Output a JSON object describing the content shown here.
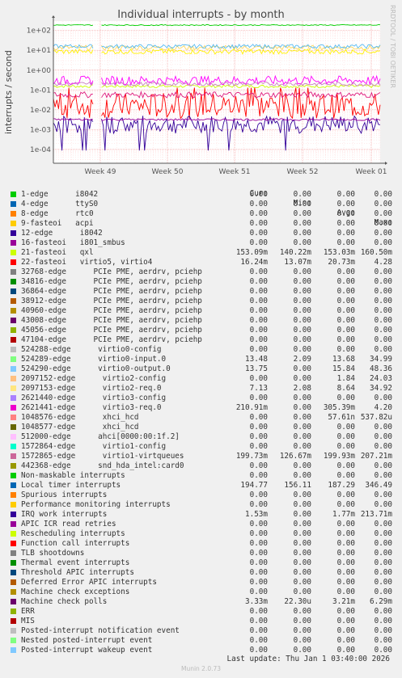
{
  "title": "Individual interrupts - by month",
  "side_label": "RRDTOOL / TOBI OETIKER",
  "ylabel": "interrupts / second",
  "footer": "Munin 2.0.73",
  "last_update": "Last update: Thu Jan  1 03:40:00 2026",
  "legend_headers": {
    "cur": "Cur:",
    "min": "Min:",
    "avg": "Avg:",
    "max": "Max:"
  },
  "chart_data": {
    "type": "line",
    "title": "Individual interrupts - by month",
    "ylabel": "interrupts / second",
    "yscale": "log",
    "ylim": [
      2e-05,
      300
    ],
    "y_ticks": [
      "1e+02",
      "1e+01",
      "1e+00",
      "1e-01",
      "1e-02",
      "1e-03",
      "1e-04"
    ],
    "x_ticks": [
      "Week 49",
      "Week 50",
      "Week 51",
      "Week 52",
      "Week 01"
    ],
    "grid": true,
    "series": [
      {
        "name": "21-fasteoi   qxl",
        "color": "#CCFF00",
        "level": 0.153,
        "noise": 0.15
      },
      {
        "name": "22-fasteoi   virtio5, virtio4",
        "color": "#FF0000",
        "level": 0.0162,
        "noise": 1.3
      },
      {
        "name": "524289-edge      virtio0-input.0",
        "color": "#FFD660",
        "level": 13.5,
        "noise": 0.25
      },
      {
        "name": "524290-edge      virtio0-output.0",
        "color": "#55BAF2",
        "level": 15.8,
        "noise": 0.2
      },
      {
        "name": "2097153-edge      virtio2-req.0",
        "color": "#FFF200",
        "level": 8.6,
        "noise": 0.25
      },
      {
        "name": "2621441-edge      virtio3-req.0",
        "color": "#FF00FF",
        "level": 0.3,
        "noise": 0.45
      },
      {
        "name": "1048576-edge      xhci_hcd",
        "color": "#DE1A7D",
        "level": 0.057,
        "noise": 0.3
      },
      {
        "name": "1572865-edge      virtio1-virtqueues",
        "color": "#C880C0",
        "level": 0.2,
        "noise": 0.2
      },
      {
        "name": "Local timer interrupts",
        "color": "#00CF00",
        "level": 187,
        "noise": 0.05
      },
      {
        "name": "IRQ work interrupts",
        "color": "#330099",
        "level": 0.00177,
        "noise": 0.9
      },
      {
        "name": "Machine check polls",
        "color": "#990099",
        "level": 0.0032,
        "noise": 0.1
      }
    ]
  },
  "legend": [
    {
      "name": "1-edge      i8042",
      "color": "#00CC00",
      "cur": "0.00",
      "min": "0.00",
      "avg": "0.00",
      "max": "0.00"
    },
    {
      "name": "4-edge      ttyS0",
      "color": "#0066B3",
      "cur": "0.00",
      "min": "0.00",
      "avg": "0.00",
      "max": "0.00"
    },
    {
      "name": "8-edge      rtc0",
      "color": "#FF8000",
      "cur": "0.00",
      "min": "0.00",
      "avg": "0.00",
      "max": "0.00"
    },
    {
      "name": "9-fasteoi   acpi",
      "color": "#FFCC00",
      "cur": "0.00",
      "min": "0.00",
      "avg": "0.00",
      "max": "0.00"
    },
    {
      "name": "12-edge      i8042",
      "color": "#330099",
      "cur": "0.00",
      "min": "0.00",
      "avg": "0.00",
      "max": "0.00"
    },
    {
      "name": "16-fasteoi   i801_smbus",
      "color": "#990099",
      "cur": "0.00",
      "min": "0.00",
      "avg": "0.00",
      "max": "0.00"
    },
    {
      "name": "21-fasteoi   qxl",
      "color": "#CCFF00",
      "cur": "153.09m",
      "min": "140.22m",
      "avg": "153.03m",
      "max": "160.50m"
    },
    {
      "name": "22-fasteoi   virtio5, virtio4",
      "color": "#FF0000",
      "cur": "16.24m",
      "min": "13.07m",
      "avg": "20.73m",
      "max": "4.28"
    },
    {
      "name": "32768-edge      PCIe PME, aerdrv, pciehp",
      "color": "#808080",
      "cur": "0.00",
      "min": "0.00",
      "avg": "0.00",
      "max": "0.00"
    },
    {
      "name": "34816-edge      PCIe PME, aerdrv, pciehp",
      "color": "#008F00",
      "cur": "0.00",
      "min": "0.00",
      "avg": "0.00",
      "max": "0.00"
    },
    {
      "name": "36864-edge      PCIe PME, aerdrv, pciehp",
      "color": "#00487D",
      "cur": "0.00",
      "min": "0.00",
      "avg": "0.00",
      "max": "0.00"
    },
    {
      "name": "38912-edge      PCIe PME, aerdrv, pciehp",
      "color": "#B35A00",
      "cur": "0.00",
      "min": "0.00",
      "avg": "0.00",
      "max": "0.00"
    },
    {
      "name": "40960-edge      PCIe PME, aerdrv, pciehp",
      "color": "#B38F00",
      "cur": "0.00",
      "min": "0.00",
      "avg": "0.00",
      "max": "0.00"
    },
    {
      "name": "43008-edge      PCIe PME, aerdrv, pciehp",
      "color": "#6B006B",
      "cur": "0.00",
      "min": "0.00",
      "avg": "0.00",
      "max": "0.00"
    },
    {
      "name": "45056-edge      PCIe PME, aerdrv, pciehp",
      "color": "#8FB300",
      "cur": "0.00",
      "min": "0.00",
      "avg": "0.00",
      "max": "0.00"
    },
    {
      "name": "47104-edge      PCIe PME, aerdrv, pciehp",
      "color": "#B30000",
      "cur": "0.00",
      "min": "0.00",
      "avg": "0.00",
      "max": "0.00"
    },
    {
      "name": "524288-edge      virtio0-config",
      "color": "#BEBEBE",
      "cur": "0.00",
      "min": "0.00",
      "avg": "0.00",
      "max": "0.00"
    },
    {
      "name": "524289-edge      virtio0-input.0",
      "color": "#80FF80",
      "cur": "13.48",
      "min": "2.09",
      "avg": "13.68",
      "max": "34.99"
    },
    {
      "name": "524290-edge      virtio0-output.0",
      "color": "#80C9FF",
      "cur": "13.75",
      "min": "0.00",
      "avg": "15.84",
      "max": "48.36"
    },
    {
      "name": "2097152-edge      virtio2-config",
      "color": "#FFC080",
      "cur": "0.00",
      "min": "0.00",
      "avg": "1.84",
      "max": "24.03"
    },
    {
      "name": "2097153-edge      virtio2-req.0",
      "color": "#FFE680",
      "cur": "7.13",
      "min": "2.08",
      "avg": "8.64",
      "max": "34.92"
    },
    {
      "name": "2621440-edge      virtio3-config",
      "color": "#AA80FF",
      "cur": "0.00",
      "min": "0.00",
      "avg": "0.00",
      "max": "0.00"
    },
    {
      "name": "2621441-edge      virtio3-req.0",
      "color": "#EE00CC",
      "cur": "210.91m",
      "min": "0.00",
      "avg": "305.39m",
      "max": "4.20"
    },
    {
      "name": "1048576-edge      xhci_hcd",
      "color": "#FF8080",
      "cur": "0.00",
      "min": "0.00",
      "avg": "57.61n",
      "max": "537.82u"
    },
    {
      "name": "1048577-edge      xhci_hcd",
      "color": "#666600",
      "cur": "0.00",
      "min": "0.00",
      "avg": "0.00",
      "max": "0.00"
    },
    {
      "name": "512000-edge      ahci[0000:00:1f.2]",
      "color": "#FFBFFF",
      "cur": "0.00",
      "min": "0.00",
      "avg": "0.00",
      "max": "0.00"
    },
    {
      "name": "1572864-edge      virtio1-config",
      "color": "#00FFCC",
      "cur": "0.00",
      "min": "0.00",
      "avg": "0.00",
      "max": "0.00"
    },
    {
      "name": "1572865-edge      virtio1-virtqueues",
      "color": "#CC6699",
      "cur": "199.73m",
      "min": "126.67m",
      "avg": "199.93m",
      "max": "207.21m"
    },
    {
      "name": "442368-edge      snd_hda_intel:card0",
      "color": "#999900",
      "cur": "0.00",
      "min": "0.00",
      "avg": "0.00",
      "max": "0.00"
    },
    {
      "name": "Non-maskable interrupts",
      "color": "#00CC00",
      "cur": "0.00",
      "min": "0.00",
      "avg": "0.00",
      "max": "0.00"
    },
    {
      "name": "Local timer interrupts",
      "color": "#0066B3",
      "cur": "194.77",
      "min": "156.11",
      "avg": "187.29",
      "max": "346.49"
    },
    {
      "name": "Spurious interrupts",
      "color": "#FF8000",
      "cur": "0.00",
      "min": "0.00",
      "avg": "0.00",
      "max": "0.00"
    },
    {
      "name": "Performance monitoring interrupts",
      "color": "#FFCC00",
      "cur": "0.00",
      "min": "0.00",
      "avg": "0.00",
      "max": "0.00"
    },
    {
      "name": "IRQ work interrupts",
      "color": "#330099",
      "cur": "1.53m",
      "min": "0.00",
      "avg": "1.77m",
      "max": "213.71m"
    },
    {
      "name": "APIC ICR read retries",
      "color": "#990099",
      "cur": "0.00",
      "min": "0.00",
      "avg": "0.00",
      "max": "0.00"
    },
    {
      "name": "Rescheduling interrupts",
      "color": "#CCFF00",
      "cur": "0.00",
      "min": "0.00",
      "avg": "0.00",
      "max": "0.00"
    },
    {
      "name": "Function call interrupts",
      "color": "#FF0000",
      "cur": "0.00",
      "min": "0.00",
      "avg": "0.00",
      "max": "0.00"
    },
    {
      "name": "TLB shootdowns",
      "color": "#808080",
      "cur": "0.00",
      "min": "0.00",
      "avg": "0.00",
      "max": "0.00"
    },
    {
      "name": "Thermal event interrupts",
      "color": "#008F00",
      "cur": "0.00",
      "min": "0.00",
      "avg": "0.00",
      "max": "0.00"
    },
    {
      "name": "Threshold APIC interrupts",
      "color": "#00487D",
      "cur": "0.00",
      "min": "0.00",
      "avg": "0.00",
      "max": "0.00"
    },
    {
      "name": "Deferred Error APIC interrupts",
      "color": "#B35A00",
      "cur": "0.00",
      "min": "0.00",
      "avg": "0.00",
      "max": "0.00"
    },
    {
      "name": "Machine check exceptions",
      "color": "#B38F00",
      "cur": "0.00",
      "min": "0.00",
      "avg": "0.00",
      "max": "0.00"
    },
    {
      "name": "Machine check polls",
      "color": "#6B006B",
      "cur": "3.33m",
      "min": "22.30u",
      "avg": "3.21m",
      "max": "6.29m"
    },
    {
      "name": "ERR",
      "color": "#8FB300",
      "cur": "0.00",
      "min": "0.00",
      "avg": "0.00",
      "max": "0.00"
    },
    {
      "name": "MIS",
      "color": "#B30000",
      "cur": "0.00",
      "min": "0.00",
      "avg": "0.00",
      "max": "0.00"
    },
    {
      "name": "Posted-interrupt notification event",
      "color": "#BEBEBE",
      "cur": "0.00",
      "min": "0.00",
      "avg": "0.00",
      "max": "0.00"
    },
    {
      "name": "Nested posted-interrupt event",
      "color": "#80FF80",
      "cur": "0.00",
      "min": "0.00",
      "avg": "0.00",
      "max": "0.00"
    },
    {
      "name": "Posted-interrupt wakeup event",
      "color": "#80C9FF",
      "cur": "0.00",
      "min": "0.00",
      "avg": "0.00",
      "max": "0.00"
    }
  ]
}
